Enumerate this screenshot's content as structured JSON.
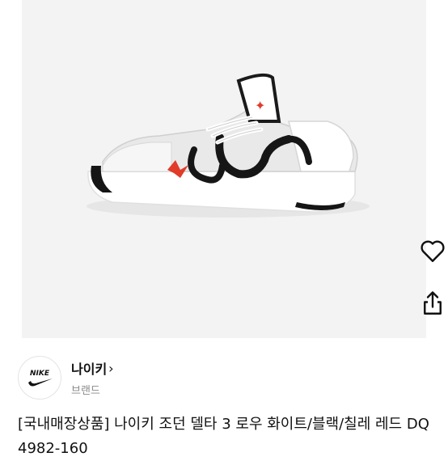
{
  "brand": {
    "logo_text": "NIKE",
    "name": "나이키",
    "chevron": "›",
    "sub_label": "브랜드"
  },
  "product": {
    "title": "[국내매장상품] 나이키 조던 델타 3 로우 화이트/블랙/칠레 레드 DQ4982-160"
  },
  "icons": {
    "favorite": "heart-outline-icon",
    "share": "share-icon"
  },
  "colors": {
    "image_bg": "#f3f3f3",
    "accent_red": "#e13b2a",
    "text_primary": "#111111",
    "text_secondary": "#8a8a8a"
  }
}
